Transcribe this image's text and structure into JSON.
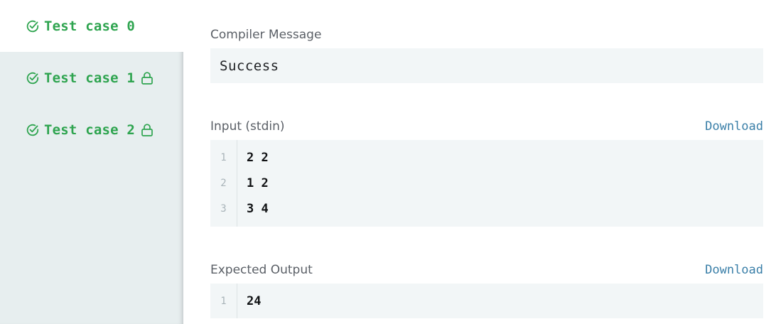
{
  "tabs": [
    {
      "label": "Test case 0",
      "active": true,
      "locked": false
    },
    {
      "label": "Test case 1",
      "active": false,
      "locked": true
    },
    {
      "label": "Test case 2",
      "active": false,
      "locked": true
    }
  ],
  "compiler": {
    "title": "Compiler Message",
    "message": "Success"
  },
  "input": {
    "title": "Input (stdin)",
    "download_label": "Download",
    "lines": [
      {
        "num": "1",
        "text": "2 2"
      },
      {
        "num": "2",
        "text": "1 2"
      },
      {
        "num": "3",
        "text": "3 4"
      }
    ]
  },
  "expected": {
    "title": "Expected Output",
    "download_label": "Download",
    "lines": [
      {
        "num": "1",
        "text": "24"
      }
    ]
  },
  "colors": {
    "success_green": "#2ea44f",
    "link_blue": "#3a7fa8",
    "sidebar_bg": "#e7eeef",
    "box_bg": "#f2f6f7"
  }
}
